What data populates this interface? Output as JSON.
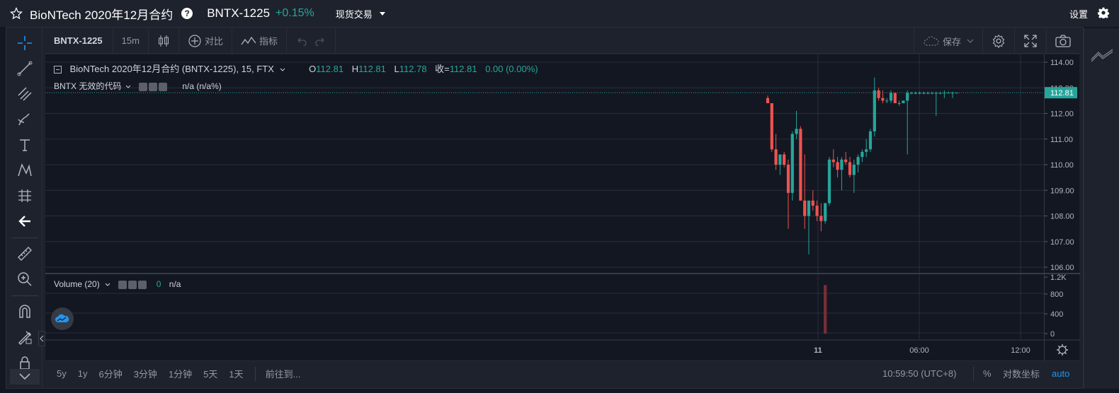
{
  "header": {
    "title": "BioNTech 2020年12月合约",
    "symbol": "BNTX-1225",
    "change": "+0.15%",
    "market_type": "现货交易",
    "settings_label": "设置"
  },
  "toolbar": {
    "symbol": "BNTX-1225",
    "interval": "15m",
    "compare_label": "对比",
    "indicators_label": "指标",
    "save_label": "保存"
  },
  "legend": {
    "main_title": "BioNTech 2020年12月合约 (BNTX-1225), 15, FTX",
    "open_label": "O",
    "open": "112.81",
    "high_label": "H",
    "high": "112.81",
    "low_label": "L",
    "low": "112.78",
    "close_label": "收=",
    "close": "112.81",
    "change": "0.00 (0.00%)",
    "secondary_title": "BNTX 无效的代码",
    "secondary_value": "n/a (n/a%)",
    "volume_title": "Volume (20)",
    "volume_value": "0",
    "volume_na": "n/a"
  },
  "price_axis": {
    "ticks": [
      "114.00",
      "113.00",
      "112.00",
      "111.00",
      "110.00",
      "109.00",
      "108.00",
      "107.00",
      "106.00"
    ],
    "last_price": "112.81"
  },
  "volume_axis": {
    "ticks": [
      "1.2K",
      "800",
      "400",
      "0"
    ]
  },
  "time_axis": {
    "ticks": [
      "11",
      "06:00",
      "12:00"
    ]
  },
  "bottom": {
    "ranges": [
      "5y",
      "1y",
      "6分钟",
      "3分钟",
      "1分钟",
      "5天",
      "1天"
    ],
    "goto_label": "前往到...",
    "clock": "10:59:50 (UTC+8)",
    "percent_label": "%",
    "log_label": "对数坐标",
    "auto_label": "auto"
  },
  "colors": {
    "up": "#26a69a",
    "down": "#ef5350",
    "background": "#131722",
    "panel": "#1e222d",
    "accent": "#2196f3"
  },
  "chart_data": {
    "type": "candlestick",
    "ylim": [
      106,
      114.2
    ],
    "candles": [
      {
        "o": 112.6,
        "h": 112.7,
        "l": 112.4,
        "c": 112.4
      },
      {
        "o": 112.4,
        "h": 112.4,
        "l": 110.5,
        "c": 110.6
      },
      {
        "o": 110.6,
        "h": 111.2,
        "l": 109.8,
        "c": 110.0
      },
      {
        "o": 110.0,
        "h": 110.4,
        "l": 109.6,
        "c": 110.4
      },
      {
        "o": 110.4,
        "h": 110.5,
        "l": 109.9,
        "c": 110.0
      },
      {
        "o": 110.0,
        "h": 110.2,
        "l": 107.5,
        "c": 108.9
      },
      {
        "o": 108.9,
        "h": 111.3,
        "l": 108.6,
        "c": 111.2
      },
      {
        "o": 111.2,
        "h": 112.1,
        "l": 111.0,
        "c": 111.4
      },
      {
        "o": 111.4,
        "h": 111.5,
        "l": 108.6,
        "c": 108.6
      },
      {
        "o": 108.6,
        "h": 110.4,
        "l": 107.5,
        "c": 108.0
      },
      {
        "o": 108.0,
        "h": 108.5,
        "l": 106.5,
        "c": 108.6
      },
      {
        "o": 108.6,
        "h": 109.0,
        "l": 108.2,
        "c": 108.4
      },
      {
        "o": 108.4,
        "h": 108.6,
        "l": 107.8,
        "c": 108.0
      },
      {
        "o": 108.0,
        "h": 108.5,
        "l": 107.4,
        "c": 107.8
      },
      {
        "o": 107.8,
        "h": 108.5,
        "l": 107.7,
        "c": 108.5
      },
      {
        "o": 108.5,
        "h": 110.3,
        "l": 108.4,
        "c": 110.2
      },
      {
        "o": 110.2,
        "h": 110.6,
        "l": 109.9,
        "c": 110.1
      },
      {
        "o": 110.1,
        "h": 110.3,
        "l": 109.5,
        "c": 109.8
      },
      {
        "o": 109.8,
        "h": 110.3,
        "l": 109.0,
        "c": 110.2
      },
      {
        "o": 110.2,
        "h": 110.5,
        "l": 110.0,
        "c": 110.1
      },
      {
        "o": 110.1,
        "h": 110.3,
        "l": 109.5,
        "c": 109.6
      },
      {
        "o": 109.6,
        "h": 110.2,
        "l": 108.9,
        "c": 110.0
      },
      {
        "o": 110.0,
        "h": 110.4,
        "l": 109.7,
        "c": 110.3
      },
      {
        "o": 110.3,
        "h": 110.6,
        "l": 110.1,
        "c": 110.5
      },
      {
        "o": 110.5,
        "h": 111.0,
        "l": 110.3,
        "c": 110.6
      },
      {
        "o": 110.6,
        "h": 111.4,
        "l": 110.5,
        "c": 111.3
      },
      {
        "o": 111.3,
        "h": 113.4,
        "l": 111.1,
        "c": 112.9
      },
      {
        "o": 112.9,
        "h": 113.0,
        "l": 112.5,
        "c": 112.6
      },
      {
        "o": 112.6,
        "h": 112.9,
        "l": 112.4,
        "c": 112.5
      },
      {
        "o": 112.5,
        "h": 112.6,
        "l": 112.4,
        "c": 112.5
      },
      {
        "o": 112.5,
        "h": 112.9,
        "l": 112.4,
        "c": 112.8
      },
      {
        "o": 112.8,
        "h": 112.8,
        "l": 112.4,
        "c": 112.4
      },
      {
        "o": 112.4,
        "h": 112.5,
        "l": 112.3,
        "c": 112.4
      },
      {
        "o": 112.4,
        "h": 112.5,
        "l": 112.4,
        "c": 112.5
      },
      {
        "o": 112.5,
        "h": 112.9,
        "l": 110.4,
        "c": 112.8
      },
      {
        "o": 112.8,
        "h": 112.85,
        "l": 112.75,
        "c": 112.8
      },
      {
        "o": 112.8,
        "h": 112.85,
        "l": 112.75,
        "c": 112.8
      },
      {
        "o": 112.8,
        "h": 112.85,
        "l": 112.75,
        "c": 112.8
      },
      {
        "o": 112.8,
        "h": 112.85,
        "l": 112.75,
        "c": 112.8
      },
      {
        "o": 112.8,
        "h": 112.85,
        "l": 112.75,
        "c": 112.8
      },
      {
        "o": 112.8,
        "h": 112.85,
        "l": 112.75,
        "c": 112.8
      },
      {
        "o": 112.8,
        "h": 112.85,
        "l": 111.9,
        "c": 112.8
      },
      {
        "o": 112.8,
        "h": 112.85,
        "l": 112.75,
        "c": 112.8
      },
      {
        "o": 112.8,
        "h": 112.9,
        "l": 112.6,
        "c": 112.81
      },
      {
        "o": 112.81,
        "h": 112.85,
        "l": 112.78,
        "c": 112.81
      },
      {
        "o": 112.81,
        "h": 112.85,
        "l": 112.6,
        "c": 112.81
      },
      {
        "o": 112.81,
        "h": 112.81,
        "l": 112.78,
        "c": 112.81
      }
    ],
    "volume": {
      "ylim": [
        0,
        1200
      ],
      "bars": [
        {
          "index": 14,
          "value": 1100,
          "direction": "down"
        }
      ]
    }
  }
}
